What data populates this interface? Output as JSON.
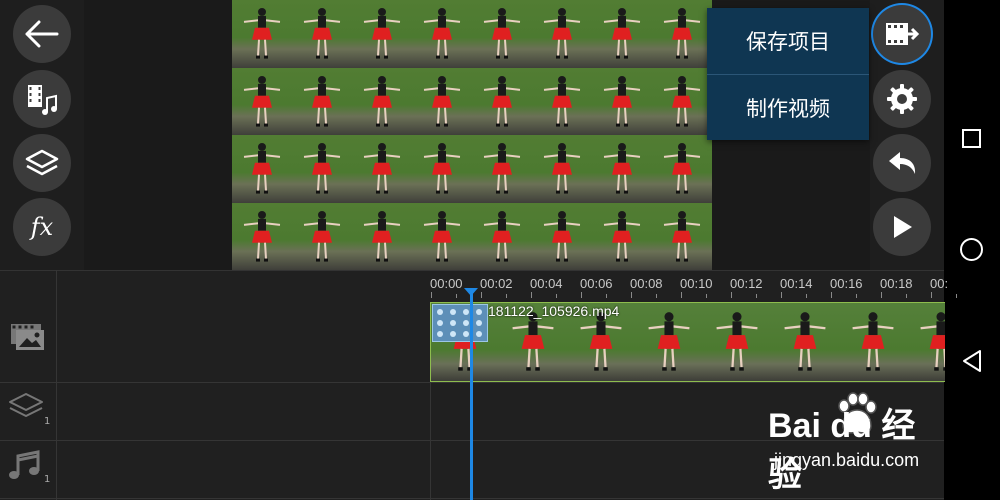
{
  "left_toolbar": {
    "buttons": [
      {
        "name": "back",
        "icon": "back-arrow-icon"
      },
      {
        "name": "media",
        "icon": "media-music-icon"
      },
      {
        "name": "layers",
        "icon": "layers-icon"
      },
      {
        "name": "effects",
        "icon": "fx-icon",
        "label": "fx"
      }
    ]
  },
  "right_toolbar": {
    "buttons": [
      {
        "name": "export",
        "icon": "film-export-icon",
        "active": true
      },
      {
        "name": "settings",
        "icon": "gear-icon"
      },
      {
        "name": "undo",
        "icon": "undo-icon"
      },
      {
        "name": "play",
        "icon": "play-icon"
      }
    ]
  },
  "export_menu": {
    "items": [
      {
        "label": "保存项目"
      },
      {
        "label": "制作视频"
      }
    ]
  },
  "timeline": {
    "ticks": [
      "00:00",
      "00:02",
      "00:04",
      "00:06",
      "00:08",
      "00:10",
      "00:12",
      "00:14",
      "00:16",
      "00:18",
      "00:"
    ],
    "video_track": {
      "clip_name": "181122_105926.mp4"
    },
    "overlay_track": {
      "count": "1"
    },
    "audio_track": {
      "count": "1"
    }
  },
  "system_nav": {
    "buttons": [
      "recents-icon",
      "home-icon",
      "back-triangle-icon"
    ]
  },
  "watermark": {
    "brand": "Bai  du 经验",
    "url": "jingyan.baidu.com"
  },
  "colors": {
    "accent": "#1e88e5",
    "menu_bg": "#0f3652",
    "clip_border": "#8ebd4e",
    "button_bg": "#3b3b3b"
  }
}
